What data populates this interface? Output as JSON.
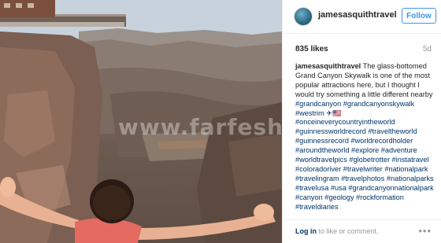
{
  "header": {
    "username": "jamesasquithtravel",
    "follow_label": "Follow"
  },
  "photo": {
    "watermark": "www.farfesh.com"
  },
  "post": {
    "likes": "835 likes",
    "time": "5d",
    "caption_user": "jamesasquithtravel",
    "caption_text": " The glass-bottomed Grand Canyon Skywalk is one of the most popular attractions here, but I thought I would try something a little different nearby ",
    "hashtags": "#grandcanyon #grandcanyonskywalk #westrim ✈🇺🇸 #onceineverycountryintheworld #guinnessworldrecord #traveltheworld #guinnessrecord #worldrecordholder #aroundtheworld #explore #adventure #worldtravelpics #globetrotter #instatravel #coloradoriver #travelwriter #nationalpark #travelingram #travelphotos #nationalparks #travelusa #usa #grandcanyonnationalpark #canyon #geology #rockformation #traveldiaries"
  },
  "footer": {
    "login_link": "Log in",
    "login_suffix": " to like or comment.",
    "more_label": "•••"
  },
  "colors": {
    "accent": "#3897f0",
    "hashtag": "#003569",
    "text": "#262626",
    "muted": "#999999"
  }
}
